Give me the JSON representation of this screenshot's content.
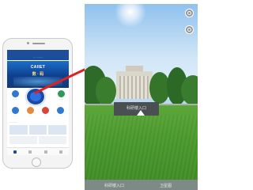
{
  "phone_app": {
    "header_title": "··· ········",
    "banner_title": "CAIIET",
    "banner_subtitle": "数 · 码",
    "icons": [
      {
        "label": "······",
        "color": "#2f78d6"
      },
      {
        "label": "······",
        "color": "#2f9a56"
      },
      {
        "label": "······",
        "color": "#2f78d6"
      },
      {
        "label": "······",
        "color": "#e7893a"
      },
      {
        "label": "······",
        "color": "#d9473a"
      },
      {
        "label": "······",
        "color": "#2f78d6"
      }
    ],
    "section_title": "··········",
    "colors": {
      "primary": "#1d4e9c",
      "accent": "#e02020"
    }
  },
  "panorama": {
    "entrance_sign": "科研楼入口",
    "bottom_labels": [
      "科研楼入口",
      "卫星图"
    ]
  }
}
